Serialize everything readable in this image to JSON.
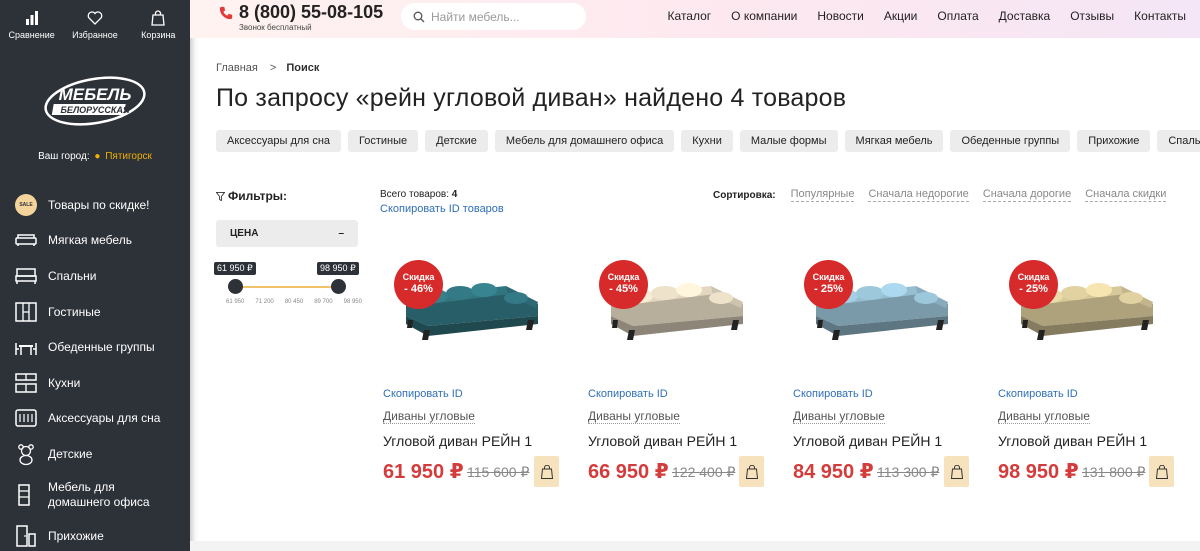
{
  "sidebar": {
    "top_icons": [
      {
        "label": "Сравнение",
        "icon": "compare-icon"
      },
      {
        "label": "Избранное",
        "icon": "heart-icon"
      },
      {
        "label": "Корзина",
        "icon": "bag-icon"
      }
    ],
    "logo": {
      "line1": "МЕБЕЛЬ",
      "line2": "БЕЛОРУССКАЯ"
    },
    "city_label": "Ваш город:",
    "city_name": "Пятигорск",
    "categories": [
      {
        "label": "Товары по скидке!",
        "icon": "sale-icon",
        "badge": "SALE"
      },
      {
        "label": "Мягкая мебель",
        "icon": "sofa-icon"
      },
      {
        "label": "Спальни",
        "icon": "bed-icon"
      },
      {
        "label": "Гостиные",
        "icon": "wardrobe-icon"
      },
      {
        "label": "Обеденные группы",
        "icon": "dining-icon"
      },
      {
        "label": "Кухни",
        "icon": "kitchen-icon"
      },
      {
        "label": "Аксессуары для сна",
        "icon": "mattress-icon"
      },
      {
        "label": "Детские",
        "icon": "teddy-icon"
      },
      {
        "label": "Мебель для домашнего офиса",
        "icon": "office-icon"
      },
      {
        "label": "Прихожие",
        "icon": "hallway-icon"
      }
    ]
  },
  "header": {
    "phone": "8 (800) 55-08-105",
    "phone_sub": "Звонок бесплатный",
    "search_placeholder": "Найти мебель...",
    "nav": [
      "Каталог",
      "О компании",
      "Новости",
      "Акции",
      "Оплата",
      "Доставка",
      "Отзывы",
      "Контакты"
    ]
  },
  "breadcrumb": {
    "home": "Главная",
    "sep": ">",
    "current": "Поиск"
  },
  "title": "По запросу «рейн угловой диван» найдено 4 товаров",
  "chips": [
    "Аксессуары для сна",
    "Гостиные",
    "Детские",
    "Мебель для домашнего офиса",
    "Кухни",
    "Малые формы",
    "Мягкая мебель",
    "Обеденные группы",
    "Прихожие",
    "Спальни"
  ],
  "filters": {
    "title": "Фильтры:",
    "price_label": "ЦЕНА",
    "toggle": "–",
    "min_tag": "61 950 ₽",
    "max_tag": "98 950 ₽",
    "ticks": [
      "61 950",
      "71 200",
      "80 450",
      "89 700",
      "98 950"
    ]
  },
  "results": {
    "total_label": "Всего товаров:",
    "total": "4",
    "copy_ids": "Скопировать ID товаров",
    "sort_label": "Сортировка:",
    "sort_options": [
      "Популярные",
      "Сначала недорогие",
      "Сначала дорогие",
      "Сначала скидки"
    ]
  },
  "products": [
    {
      "badge_label": "Скидка",
      "discount": "- 46%",
      "copy": "Скопировать ID",
      "category": "Диваны угловые",
      "name": "Угловой диван РЕЙН 1",
      "price": "61 950 ₽",
      "old_price": "115 600 ₽",
      "color": "#2f6f7a"
    },
    {
      "badge_label": "Скидка",
      "discount": "- 45%",
      "copy": "Скопировать ID",
      "category": "Диваны угловые",
      "name": "Угловой диван РЕЙН 1",
      "price": "66 950 ₽",
      "old_price": "122 400 ₽",
      "color": "#d9cdb8"
    },
    {
      "badge_label": "Скидка",
      "discount": "- 25%",
      "copy": "Скопировать ID",
      "category": "Диваны угловые",
      "name": "Угловой диван РЕЙН 1",
      "price": "84 950 ₽",
      "old_price": "113 300 ₽",
      "color": "#8fb5c7"
    },
    {
      "badge_label": "Скидка",
      "discount": "- 25%",
      "copy": "Скопировать ID",
      "category": "Диваны угловые",
      "name": "Угловой диван РЕЙН 1",
      "price": "98 950 ₽",
      "old_price": "131 800 ₽",
      "color": "#cdbf93"
    }
  ]
}
